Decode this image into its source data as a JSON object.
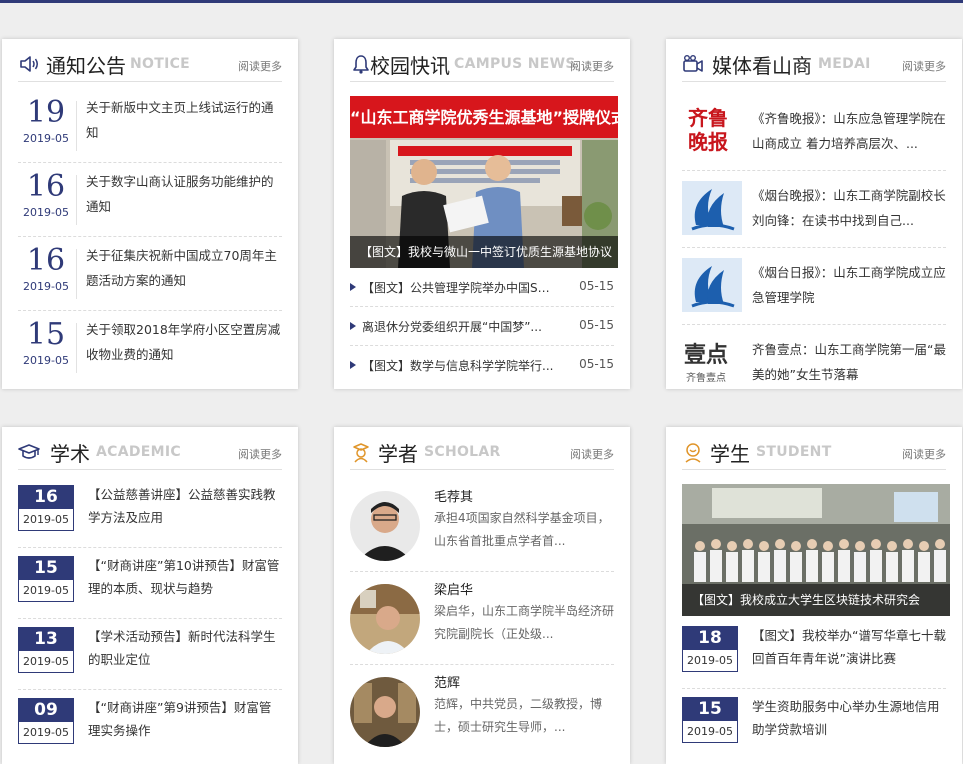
{
  "colors": {
    "accent": "#2f3a78",
    "sub_title": "#c8c8c8",
    "background": "#eeeeee"
  },
  "notice": {
    "icon": "speaker-icon",
    "title": "通知公告",
    "subtitle": "NOTICE",
    "more": "阅读更多",
    "items": [
      {
        "day": "19",
        "ym": "2019-05",
        "text": "关于新版中文主页上线试运行的通知"
      },
      {
        "day": "16",
        "ym": "2019-05",
        "text": "关于数字山商认证服务功能维护的通知"
      },
      {
        "day": "16",
        "ym": "2019-05",
        "text": "关于征集庆祝新中国成立70周年主题活动方案的通知"
      },
      {
        "day": "15",
        "ym": "2019-05",
        "text": "关于领取2018年学府小区空置房减收物业费的通知"
      }
    ]
  },
  "news": {
    "icon": "bell-icon",
    "title": "校园快讯",
    "subtitle": "CAMPUS NEWS",
    "more": "阅读更多",
    "photo_banner": "“山东工商学院优秀生源基地”授牌仪式",
    "photo_caption": "【图文】我校与微山一中签订优质生源基地协议",
    "items": [
      {
        "text": "【图文】公共管理学院举办中国SOS...",
        "date": "05-15"
      },
      {
        "text": "离退休分党委组织开展“中国梦”...",
        "date": "05-15"
      },
      {
        "text": "【图文】数学与信息科学学院举行...",
        "date": "05-15"
      }
    ]
  },
  "media": {
    "icon": "camera-icon",
    "title": "媒体看山商",
    "subtitle": "MEDAI",
    "more": "阅读更多",
    "items": [
      {
        "logo": "qilu-evening-logo",
        "logo_text": "齐鲁晚报",
        "text": "《齐鲁晚报》：山东应急管理学院在山商成立 着力培养高层次、..."
      },
      {
        "logo": "yantai-evening-logo",
        "text": "《烟台晚报》：山东工商学院副校长刘向锋：在读书中找到自己..."
      },
      {
        "logo": "yantai-daily-logo",
        "text": "《烟台日报》：山东工商学院成立应急管理学院"
      },
      {
        "logo": "qilu-yidian-logo",
        "logo_text": "壹点",
        "logo_sub": "齐鲁壹点",
        "text": "齐鲁壹点：山东工商学院第一届“最美的她”女生节落幕"
      }
    ]
  },
  "academic": {
    "icon": "graduation-cap-icon",
    "title": "学术",
    "subtitle": "ACADEMIC",
    "more": "阅读更多",
    "items": [
      {
        "day": "16",
        "ym": "2019-05",
        "text": "【公益慈善讲座】公益慈善实践教学方法及应用"
      },
      {
        "day": "15",
        "ym": "2019-05",
        "text": "【“财商讲座”第10讲预告】财富管理的本质、现状与趋势"
      },
      {
        "day": "13",
        "ym": "2019-05",
        "text": "【学术活动预告】新时代法科学生的职业定位"
      },
      {
        "day": "09",
        "ym": "2019-05",
        "text": "【“财商讲座”第9讲预告】财富管理实务操作"
      }
    ]
  },
  "scholar": {
    "icon": "scholar-icon",
    "title": "学者",
    "subtitle": "SCHOLAR",
    "more": "阅读更多",
    "items": [
      {
        "name": "毛荐其",
        "desc": "承担4项国家自然科学基金项目，山东省首批重点学者首..."
      },
      {
        "name": "梁启华",
        "desc": "梁启华，山东工商学院半岛经济研究院副院长（正处级..."
      },
      {
        "name": "范辉",
        "desc": "范辉，中共党员，二级教授，博士，硕士研究生导师，..."
      }
    ]
  },
  "student": {
    "icon": "student-icon",
    "title": "学生",
    "subtitle": "STUDENT",
    "more": "阅读更多",
    "photo_caption": "【图文】我校成立大学生区块链技术研究会",
    "items": [
      {
        "day": "18",
        "ym": "2019-05",
        "text": "【图文】我校举办“谱写华章七十载 回首百年青年说”演讲比赛"
      },
      {
        "day": "15",
        "ym": "2019-05",
        "text": "学生资助服务中心举办生源地信用助学贷款培训"
      }
    ]
  }
}
